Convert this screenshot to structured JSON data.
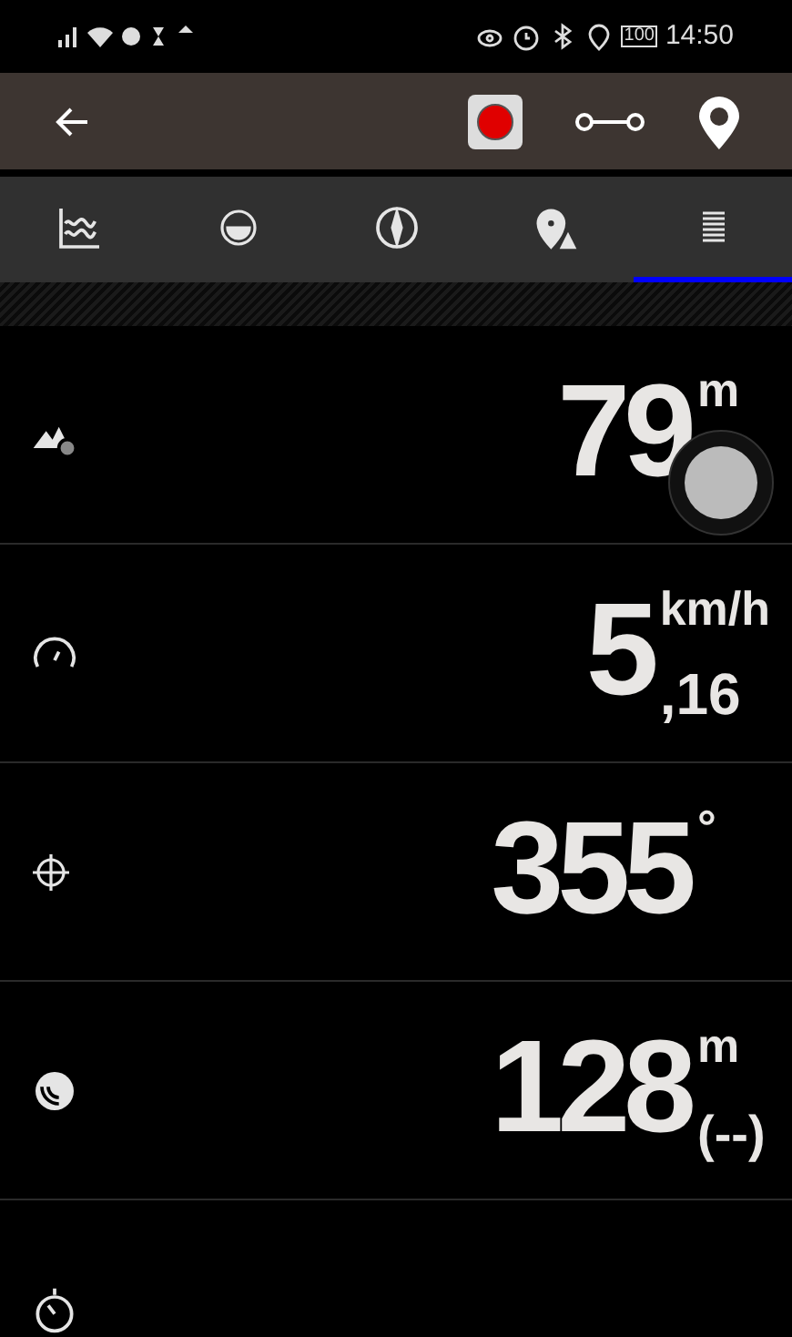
{
  "status_bar": {
    "battery": "100",
    "time": "14:50"
  },
  "tabs": [
    {
      "kind": "chart",
      "selected": false
    },
    {
      "kind": "level",
      "selected": false
    },
    {
      "kind": "compass",
      "selected": false
    },
    {
      "kind": "location",
      "selected": false
    },
    {
      "kind": "list",
      "selected": true
    }
  ],
  "rows": [
    {
      "kind": "altitude",
      "value": "79",
      "unit": "m"
    },
    {
      "kind": "speed",
      "value": "5",
      "decimal": ",16",
      "unit": "km/h"
    },
    {
      "kind": "heading",
      "value": "355",
      "unit": "°"
    },
    {
      "kind": "accuracy",
      "value": "128",
      "unit": "m",
      "sub": "(--)"
    },
    {
      "kind": "timer"
    }
  ]
}
